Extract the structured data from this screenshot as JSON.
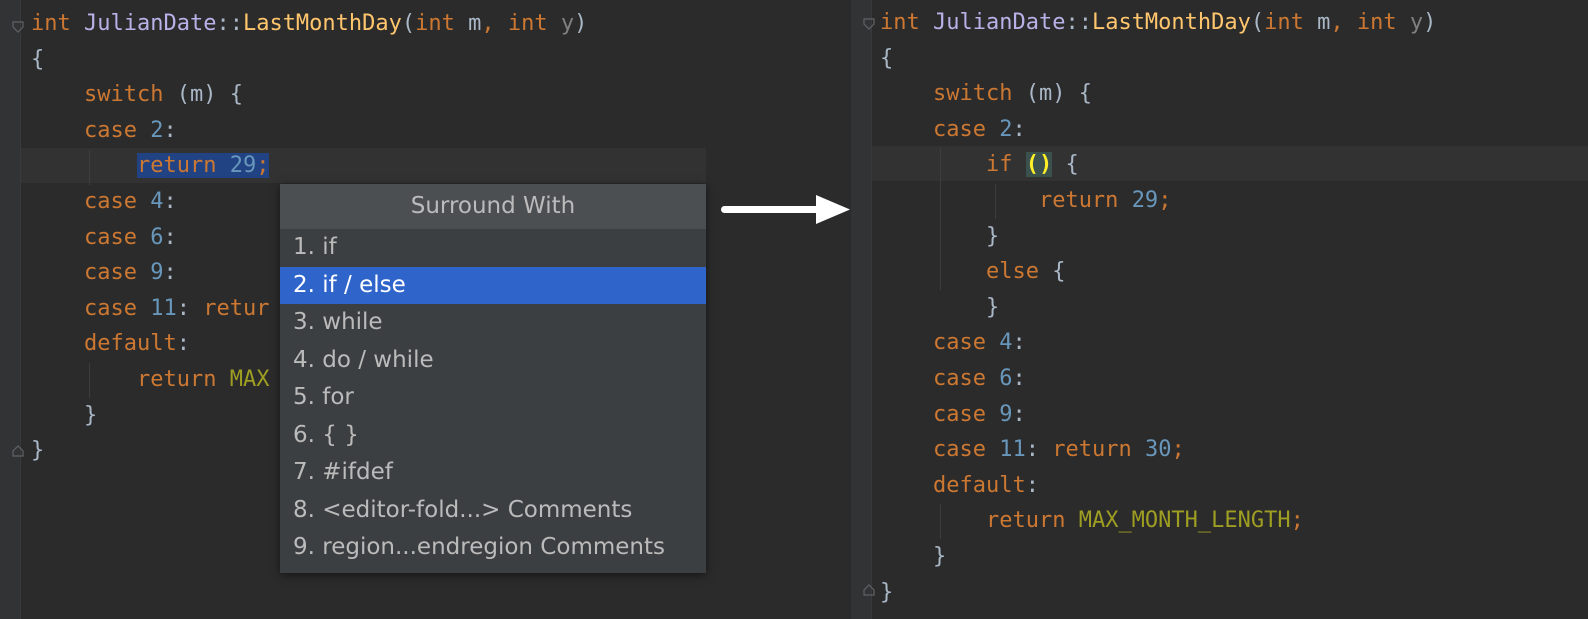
{
  "left_editor": {
    "lines": [
      {
        "segments": [
          {
            "t": "int",
            "c": "kw"
          },
          {
            "t": " ",
            "c": "op"
          },
          {
            "t": "JulianDate",
            "c": "cls"
          },
          {
            "t": "::",
            "c": "op"
          },
          {
            "t": "LastMonthDay",
            "c": "fn"
          },
          {
            "t": "(",
            "c": "op"
          },
          {
            "t": "int",
            "c": "kw"
          },
          {
            "t": " m",
            "c": "param"
          },
          {
            "t": ", ",
            "c": "kw"
          },
          {
            "t": "int",
            "c": "kw"
          },
          {
            "t": " y",
            "c": "faint"
          },
          {
            "t": ")",
            "c": "op"
          }
        ]
      },
      {
        "segments": [
          {
            "t": "{",
            "c": "op"
          }
        ]
      },
      {
        "segments": [
          {
            "t": "    ",
            "c": "op"
          },
          {
            "t": "switch",
            "c": "kw"
          },
          {
            "t": " (m) {",
            "c": "op"
          }
        ]
      },
      {
        "segments": [
          {
            "t": "    ",
            "c": "op"
          },
          {
            "t": "case",
            "c": "kw"
          },
          {
            "t": " ",
            "c": "op"
          },
          {
            "t": "2",
            "c": "num"
          },
          {
            "t": ":",
            "c": "op"
          }
        ]
      },
      {
        "segments": [
          {
            "t": "        ",
            "c": "op"
          },
          {
            "t": "return",
            "c": "kw sel"
          },
          {
            "t": " ",
            "c": "op sel"
          },
          {
            "t": "29",
            "c": "num sel"
          },
          {
            "t": ";",
            "c": "kw sel"
          }
        ]
      },
      {
        "segments": [
          {
            "t": "    ",
            "c": "op"
          },
          {
            "t": "case",
            "c": "kw"
          },
          {
            "t": " ",
            "c": "op"
          },
          {
            "t": "4",
            "c": "num"
          },
          {
            "t": ":",
            "c": "op"
          }
        ]
      },
      {
        "segments": [
          {
            "t": "    ",
            "c": "op"
          },
          {
            "t": "case",
            "c": "kw"
          },
          {
            "t": " ",
            "c": "op"
          },
          {
            "t": "6",
            "c": "num"
          },
          {
            "t": ":",
            "c": "op"
          }
        ]
      },
      {
        "segments": [
          {
            "t": "    ",
            "c": "op"
          },
          {
            "t": "case",
            "c": "kw"
          },
          {
            "t": " ",
            "c": "op"
          },
          {
            "t": "9",
            "c": "num"
          },
          {
            "t": ":",
            "c": "op"
          }
        ]
      },
      {
        "segments": [
          {
            "t": "    ",
            "c": "op"
          },
          {
            "t": "case",
            "c": "kw"
          },
          {
            "t": " ",
            "c": "op"
          },
          {
            "t": "11",
            "c": "num"
          },
          {
            "t": ": ",
            "c": "op"
          },
          {
            "t": "retur",
            "c": "kw"
          }
        ]
      },
      {
        "segments": [
          {
            "t": "    ",
            "c": "op"
          },
          {
            "t": "default",
            "c": "kw"
          },
          {
            "t": ":",
            "c": "op"
          }
        ]
      },
      {
        "segments": [
          {
            "t": "        ",
            "c": "op"
          },
          {
            "t": "return",
            "c": "kw"
          },
          {
            "t": " ",
            "c": "op"
          },
          {
            "t": "MAX",
            "c": "const"
          }
        ]
      },
      {
        "segments": [
          {
            "t": "    }",
            "c": "op"
          }
        ]
      },
      {
        "segments": [
          {
            "t": "}",
            "c": "op"
          }
        ]
      }
    ]
  },
  "popup": {
    "title": "Surround With",
    "items": [
      "1. if",
      "2. if / else",
      "3. while",
      "4. do / while",
      "5. for",
      "6. { }",
      "7. #ifdef",
      "8. <editor-fold...> Comments",
      "9. region...endregion Comments"
    ],
    "selected_index": 1
  },
  "right_editor": {
    "lines": [
      {
        "segments": [
          {
            "t": "int",
            "c": "kw"
          },
          {
            "t": " ",
            "c": "op"
          },
          {
            "t": "JulianDate",
            "c": "cls"
          },
          {
            "t": "::",
            "c": "op"
          },
          {
            "t": "LastMonthDay",
            "c": "fn"
          },
          {
            "t": "(",
            "c": "op"
          },
          {
            "t": "int",
            "c": "kw"
          },
          {
            "t": " m",
            "c": "param"
          },
          {
            "t": ", ",
            "c": "kw"
          },
          {
            "t": "int",
            "c": "kw"
          },
          {
            "t": " y",
            "c": "faint"
          },
          {
            "t": ")",
            "c": "op"
          }
        ]
      },
      {
        "segments": [
          {
            "t": "{",
            "c": "op"
          }
        ]
      },
      {
        "segments": [
          {
            "t": "    ",
            "c": "op"
          },
          {
            "t": "switch",
            "c": "kw"
          },
          {
            "t": " (m) {",
            "c": "op"
          }
        ]
      },
      {
        "segments": [
          {
            "t": "    ",
            "c": "op"
          },
          {
            "t": "case",
            "c": "kw"
          },
          {
            "t": " ",
            "c": "op"
          },
          {
            "t": "2",
            "c": "num"
          },
          {
            "t": ":",
            "c": "op"
          }
        ]
      },
      {
        "segments": [
          {
            "t": "        ",
            "c": "op"
          },
          {
            "t": "if",
            "c": "kw"
          },
          {
            "t": " ",
            "c": "op"
          },
          {
            "t": "()",
            "c": "paren-hl"
          },
          {
            "t": " {",
            "c": "op"
          }
        ]
      },
      {
        "segments": [
          {
            "t": "            ",
            "c": "op"
          },
          {
            "t": "return",
            "c": "kw"
          },
          {
            "t": " ",
            "c": "op"
          },
          {
            "t": "29",
            "c": "num"
          },
          {
            "t": ";",
            "c": "kw"
          }
        ]
      },
      {
        "segments": [
          {
            "t": "        }",
            "c": "op"
          }
        ]
      },
      {
        "segments": [
          {
            "t": "        ",
            "c": "op"
          },
          {
            "t": "else",
            "c": "kw"
          },
          {
            "t": " {",
            "c": "op"
          }
        ]
      },
      {
        "segments": [
          {
            "t": "        }",
            "c": "op"
          }
        ]
      },
      {
        "segments": [
          {
            "t": "    ",
            "c": "op"
          },
          {
            "t": "case",
            "c": "kw"
          },
          {
            "t": " ",
            "c": "op"
          },
          {
            "t": "4",
            "c": "num"
          },
          {
            "t": ":",
            "c": "op"
          }
        ]
      },
      {
        "segments": [
          {
            "t": "    ",
            "c": "op"
          },
          {
            "t": "case",
            "c": "kw"
          },
          {
            "t": " ",
            "c": "op"
          },
          {
            "t": "6",
            "c": "num"
          },
          {
            "t": ":",
            "c": "op"
          }
        ]
      },
      {
        "segments": [
          {
            "t": "    ",
            "c": "op"
          },
          {
            "t": "case",
            "c": "kw"
          },
          {
            "t": " ",
            "c": "op"
          },
          {
            "t": "9",
            "c": "num"
          },
          {
            "t": ":",
            "c": "op"
          }
        ]
      },
      {
        "segments": [
          {
            "t": "    ",
            "c": "op"
          },
          {
            "t": "case",
            "c": "kw"
          },
          {
            "t": " ",
            "c": "op"
          },
          {
            "t": "11",
            "c": "num"
          },
          {
            "t": ": ",
            "c": "op"
          },
          {
            "t": "return",
            "c": "kw"
          },
          {
            "t": " ",
            "c": "op"
          },
          {
            "t": "30",
            "c": "num"
          },
          {
            "t": ";",
            "c": "kw"
          }
        ]
      },
      {
        "segments": [
          {
            "t": "    ",
            "c": "op"
          },
          {
            "t": "default",
            "c": "kw"
          },
          {
            "t": ":",
            "c": "op"
          }
        ]
      },
      {
        "segments": [
          {
            "t": "        ",
            "c": "op"
          },
          {
            "t": "return",
            "c": "kw"
          },
          {
            "t": " ",
            "c": "op"
          },
          {
            "t": "MAX_MONTH_LENGTH",
            "c": "const"
          },
          {
            "t": ";",
            "c": "kw"
          }
        ]
      },
      {
        "segments": [
          {
            "t": "    }",
            "c": "op"
          }
        ]
      },
      {
        "segments": [
          {
            "t": "}",
            "c": "op"
          }
        ]
      }
    ]
  }
}
